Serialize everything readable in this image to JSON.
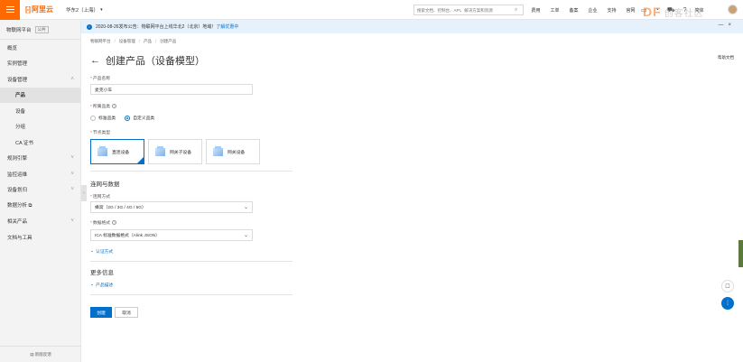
{
  "topbar": {
    "logo_text": "阿里云",
    "logo_bracket": "[-]",
    "region": "华东2（上海）",
    "search_placeholder": "搜索文档、控制台、API、解决方案和资源",
    "nav": [
      "费用",
      "工单",
      "备案",
      "企业",
      "支持",
      "官网"
    ],
    "lang": "简体",
    "watermark": "DF",
    "watermark_sub": "创客社区"
  },
  "sidebar": {
    "title": "物联网平台",
    "tag": "公共",
    "items": [
      {
        "label": "概览",
        "chev": ""
      },
      {
        "label": "实例管理",
        "chev": ""
      },
      {
        "label": "设备管理",
        "chev": "˄"
      },
      {
        "label": "产品",
        "chev": "",
        "sub": true,
        "active": true
      },
      {
        "label": "设备",
        "chev": "",
        "sub": true
      },
      {
        "label": "分组",
        "chev": "",
        "sub": true
      },
      {
        "label": "CA 证书",
        "chev": "",
        "sub": true
      },
      {
        "label": "规则引擎",
        "chev": "˅"
      },
      {
        "label": "监控运维",
        "chev": "˅"
      },
      {
        "label": "设备划归",
        "chev": "˅"
      },
      {
        "label": "数据分析 ⧉",
        "chev": ""
      },
      {
        "label": "相关产品",
        "chev": "˅"
      },
      {
        "label": "文档与工具",
        "chev": ""
      }
    ],
    "bottom": "新版反馈"
  },
  "notice": {
    "text": "2020-08-26发布公告：物联网平台上线华北2（北京）地域！",
    "link": "了解优惠中"
  },
  "breadcrumb": [
    "物联网平台",
    "设备管理",
    "产品",
    "创建产品"
  ],
  "page": {
    "title": "创建产品（设备模型）",
    "help": "帮助文档"
  },
  "form": {
    "product_name_label": "产品名称",
    "product_name_value": "麦克小车",
    "category_label": "所属品类",
    "category_options": [
      {
        "label": "标准品类",
        "checked": false
      },
      {
        "label": "自定义品类",
        "checked": true
      }
    ],
    "node_type_label": "节点类型",
    "node_types": [
      {
        "label": "直连设备",
        "selected": true
      },
      {
        "label": "网关子设备",
        "selected": false
      },
      {
        "label": "网关设备",
        "selected": false
      }
    ],
    "network_section": "连网与数据",
    "network_label": "连网方式",
    "network_value": "蜂窝（2G / 3G / 4G / 5G）",
    "data_format_label": "数据格式",
    "data_format_value": "ICA 标准数据格式（Alink JSON）",
    "auth_link": "认证方式",
    "more_section": "更多信息",
    "desc_link": "产品描述",
    "submit": "创建",
    "cancel": "取消"
  },
  "colors": {
    "brand": "#ff6a00",
    "primary": "#0070cc"
  }
}
